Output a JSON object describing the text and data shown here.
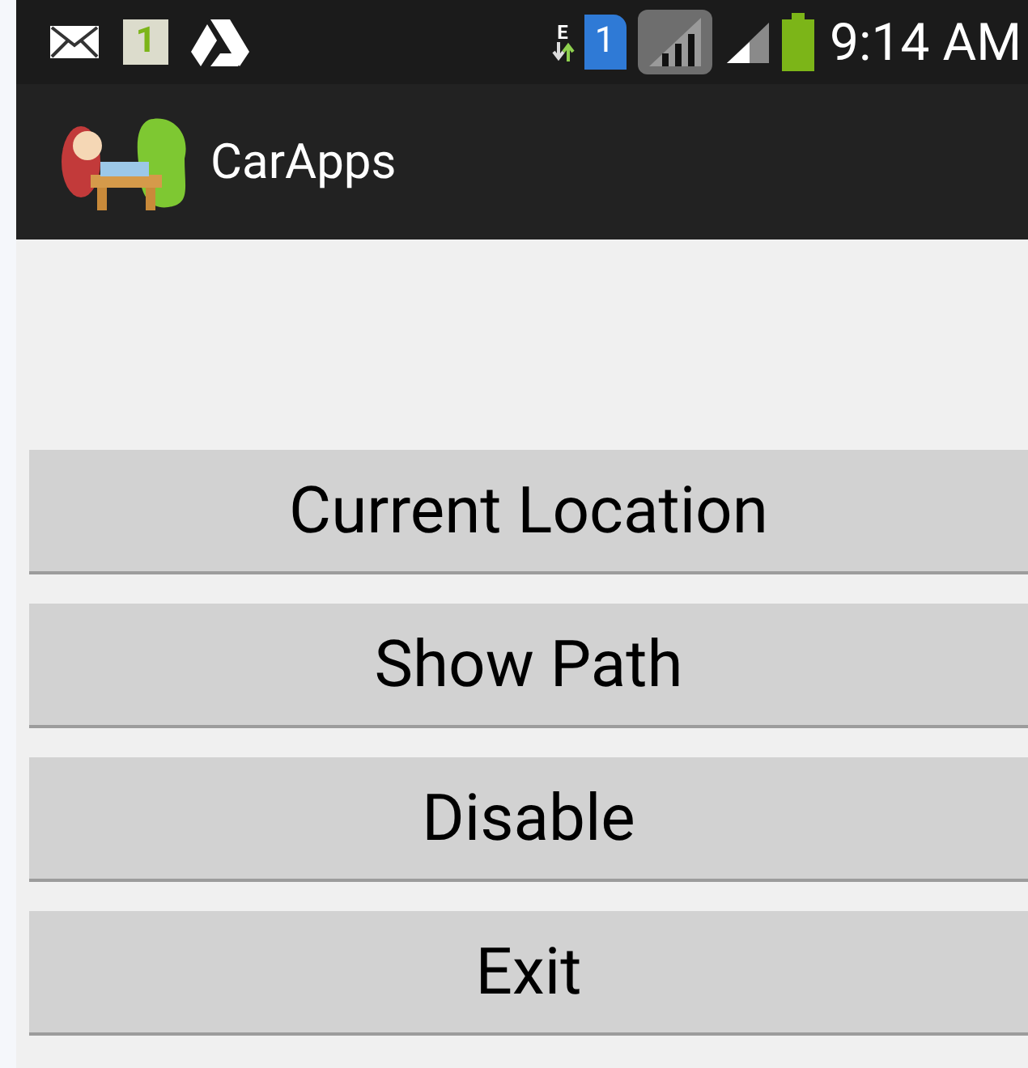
{
  "status_bar": {
    "notifications": [
      {
        "kind": "mail"
      },
      {
        "kind": "badge",
        "text": "1"
      },
      {
        "kind": "drive"
      }
    ],
    "data_type": "E",
    "sim": "1",
    "time": "9:14 AM"
  },
  "action_bar": {
    "title": "CarApps"
  },
  "buttons": [
    {
      "label": "Current Location"
    },
    {
      "label": "Show Path"
    },
    {
      "label": "Disable"
    },
    {
      "label": "Exit"
    }
  ]
}
